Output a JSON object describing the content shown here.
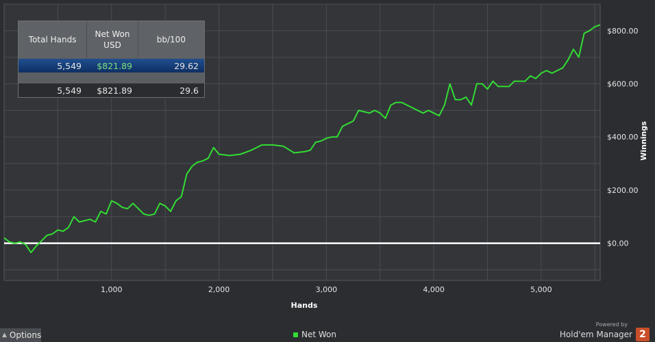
{
  "chart_data": {
    "type": "line",
    "xlabel": "Hands",
    "ylabel": "Winnings",
    "xlim": [
      0,
      5549
    ],
    "ylim": [
      -140,
      900
    ],
    "x_ticks": [
      1000,
      2000,
      3000,
      4000,
      5000
    ],
    "x_tick_labels": [
      "1,000",
      "2,000",
      "3,000",
      "4,000",
      "5,000"
    ],
    "y_ticks": [
      0,
      200,
      400,
      600,
      800
    ],
    "y_tick_labels": [
      "$0.00",
      "$200.00",
      "$400.00",
      "$600.00",
      "$800.00"
    ],
    "legend_position": "bottom-center",
    "grid": true,
    "series": [
      {
        "name": "Net Won",
        "color": "#33dd33",
        "x": [
          0,
          50,
          100,
          150,
          200,
          250,
          300,
          350,
          400,
          450,
          500,
          550,
          600,
          650,
          700,
          750,
          800,
          850,
          900,
          950,
          1000,
          1050,
          1100,
          1150,
          1200,
          1250,
          1300,
          1350,
          1400,
          1450,
          1500,
          1550,
          1600,
          1650,
          1700,
          1750,
          1800,
          1850,
          1900,
          1950,
          2000,
          2100,
          2200,
          2300,
          2400,
          2500,
          2600,
          2700,
          2800,
          2850,
          2900,
          2950,
          3000,
          3050,
          3100,
          3150,
          3200,
          3250,
          3300,
          3400,
          3450,
          3500,
          3550,
          3600,
          3650,
          3700,
          3800,
          3900,
          3950,
          4000,
          4050,
          4100,
          4150,
          4200,
          4250,
          4300,
          4350,
          4400,
          4450,
          4500,
          4550,
          4600,
          4650,
          4700,
          4750,
          4800,
          4850,
          4900,
          4950,
          5000,
          5050,
          5100,
          5150,
          5200,
          5250,
          5300,
          5350,
          5400,
          5450,
          5500,
          5549
        ],
        "y": [
          20,
          5,
          0,
          5,
          -5,
          -35,
          -10,
          10,
          30,
          35,
          50,
          45,
          60,
          100,
          80,
          85,
          90,
          80,
          120,
          110,
          160,
          150,
          135,
          130,
          150,
          130,
          110,
          105,
          110,
          150,
          140,
          120,
          160,
          175,
          260,
          290,
          305,
          310,
          320,
          360,
          335,
          330,
          335,
          350,
          370,
          370,
          365,
          340,
          345,
          350,
          380,
          385,
          395,
          400,
          400,
          440,
          450,
          460,
          500,
          490,
          500,
          490,
          470,
          520,
          530,
          530,
          510,
          490,
          500,
          490,
          480,
          520,
          600,
          540,
          540,
          550,
          520,
          600,
          600,
          580,
          610,
          590,
          590,
          590,
          610,
          610,
          610,
          630,
          620,
          640,
          650,
          640,
          650,
          660,
          690,
          730,
          700,
          790,
          800,
          815,
          822
        ]
      }
    ],
    "zero_line_color": "#ffffff"
  },
  "stats": {
    "headers": [
      "Total Hands",
      "Net Won USD",
      "bb/100"
    ],
    "selected_row": [
      "5,549",
      "$821.89",
      "29.62"
    ],
    "total_row": [
      "5,549",
      "$821.89",
      "29.6"
    ]
  },
  "options_label": "Options",
  "brand": {
    "powered_by": "Powered by",
    "name": "Hold'em Manager",
    "badge": "2"
  }
}
